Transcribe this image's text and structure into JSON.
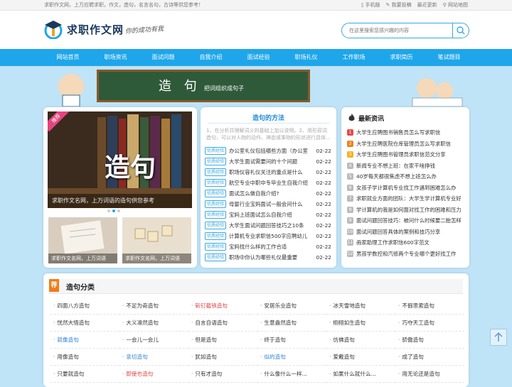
{
  "topbar": {
    "tagline": "求职作文网，上万应聘求职，作文，造句，名言名句，古诗等供您参考！",
    "links": [
      "手机版",
      "我要投稿",
      "最近更新",
      "网站地图"
    ]
  },
  "header": {
    "logo_text": "求职作文网",
    "slogan": "你的成功有我",
    "search_placeholder": "在这里搜索您感兴趣的内容"
  },
  "nav": [
    "网站首页",
    "职场资讯",
    "面试问题",
    "自我介绍",
    "面试经验",
    "职场礼仪",
    "工作职场",
    "求职简历",
    "笔试题目"
  ],
  "banner": {
    "title": "造 句",
    "subtitle": "把词组织成句子"
  },
  "featured": {
    "badge": "推荐",
    "big_text": "造句",
    "caption": "求职作文名网，上万词语的造句供您参考",
    "thumb1_caption": "求职作文名网，上万词语",
    "thumb2_caption": "求职作文名网，上万词语",
    "active_dot": 1
  },
  "methods": {
    "title": "造句的方法",
    "intro": "1、在分析并理解词义的基础上加以说明。2、用形容词造句，可以对人物的动作、神态或事物的形状进行具体...",
    "tag": "优质经验",
    "items": [
      {
        "title": "办公室礼仪包括哪些方面（办公室",
        "date": "02-22"
      },
      {
        "title": "大学生面试需要问的十个问题",
        "date": "02-22"
      },
      {
        "title": "职场仪容礼仪关注的重点是什么",
        "date": "02-22"
      },
      {
        "title": "航空专业中职中专毕业生自我介绍",
        "date": "02-22"
      },
      {
        "title": "面试怎么做自我介绍?",
        "date": "02-22"
      },
      {
        "title": "母婴行业宝妈面试一般会问什么",
        "date": "02-22"
      },
      {
        "title": "宝妈上班面试怎么自我介绍",
        "date": "02-22"
      },
      {
        "title": "大学生面试问题回答技巧之10条",
        "date": "02-22"
      },
      {
        "title": "计算机专业求职信500字应聘幼儿",
        "date": "02-22"
      },
      {
        "title": "宝妈找什么样的工作合适",
        "date": "02-22"
      },
      {
        "title": "职场中你认为哪些礼仪最重要",
        "date": "02-22"
      }
    ]
  },
  "latest": {
    "title": "最新资讯",
    "colors": [
      "#e84a4a",
      "#f0811e",
      "#f4b321",
      "#bbbbbb"
    ],
    "items": [
      "大学生应聘图书销售员怎么写求职信",
      "大学生应聘医院仓库管理员怎么写求职信",
      "大学生应聘图书管理员求职信范文分享",
      "新闻专业不想上班：在家干啥挣钱",
      "40岁每天都很焦虑不想上班怎么办",
      "女孩子学计算机专业找工作遇到困难怎么办",
      "求职就业方面的团队：大学生学计算机专业好",
      "学计算机的我是如何面对找工作的困难和压力",
      "面试问题回答技巧：被问什么时候要二胎怎样",
      "面试问题回答具体的案例和技巧分享",
      "画家助理工作求职信600字范文",
      "男孩学数控和汽修两个专业哪个更好找工作"
    ]
  },
  "categories": {
    "icon": "荐",
    "title": "造句分类",
    "items": [
      {
        "text": "四面八方造句",
        "color": "#333333"
      },
      {
        "text": "不足为奇造句",
        "color": "#333333"
      },
      {
        "text": "斩钉截铁造句",
        "color": "#e04040"
      },
      {
        "text": "安居乐业造句",
        "color": "#333333"
      },
      {
        "text": "冰天雪地造句",
        "color": "#333333"
      },
      {
        "text": "不假思索造句",
        "color": "#333333"
      },
      {
        "text": "恍然大悟造句",
        "color": "#333333"
      },
      {
        "text": "大义凛然造句",
        "color": "#333333"
      },
      {
        "text": "自言自语造句",
        "color": "#333333"
      },
      {
        "text": "生意盎然造句",
        "color": "#333333"
      },
      {
        "text": "栩栩如生造句",
        "color": "#333333"
      },
      {
        "text": "巧夺天工造句",
        "color": "#333333"
      },
      {
        "text": "就像造句",
        "color": "#2a7fd4"
      },
      {
        "text": "一会儿一会儿",
        "color": "#333333"
      },
      {
        "text": "但是造句",
        "color": "#333333"
      },
      {
        "text": "终于造句",
        "color": "#333333"
      },
      {
        "text": "仿佛造句",
        "color": "#333333"
      },
      {
        "text": "骄傲造句",
        "color": "#333333"
      },
      {
        "text": "用像造句",
        "color": "#333333"
      },
      {
        "text": "亲切造句",
        "color": "#2a7fd4"
      },
      {
        "text": "犹如造句",
        "color": "#333333"
      },
      {
        "text": "似的造句",
        "color": "#2a7fd4"
      },
      {
        "text": "爱戴造句",
        "color": "#333333"
      },
      {
        "text": "成了造句",
        "color": "#333333"
      },
      {
        "text": "只要就造句",
        "color": "#333333"
      },
      {
        "text": "即使也造句",
        "color": "#e04040"
      },
      {
        "text": "只有才造句",
        "color": "#333333"
      },
      {
        "text": "什么像什么一样...",
        "color": "#333333"
      },
      {
        "text": "如果什么就什么...",
        "color": "#333333"
      },
      {
        "text": "用无论还是造句",
        "color": "#333333"
      }
    ]
  },
  "totop_icon": "arrow-up-icon"
}
